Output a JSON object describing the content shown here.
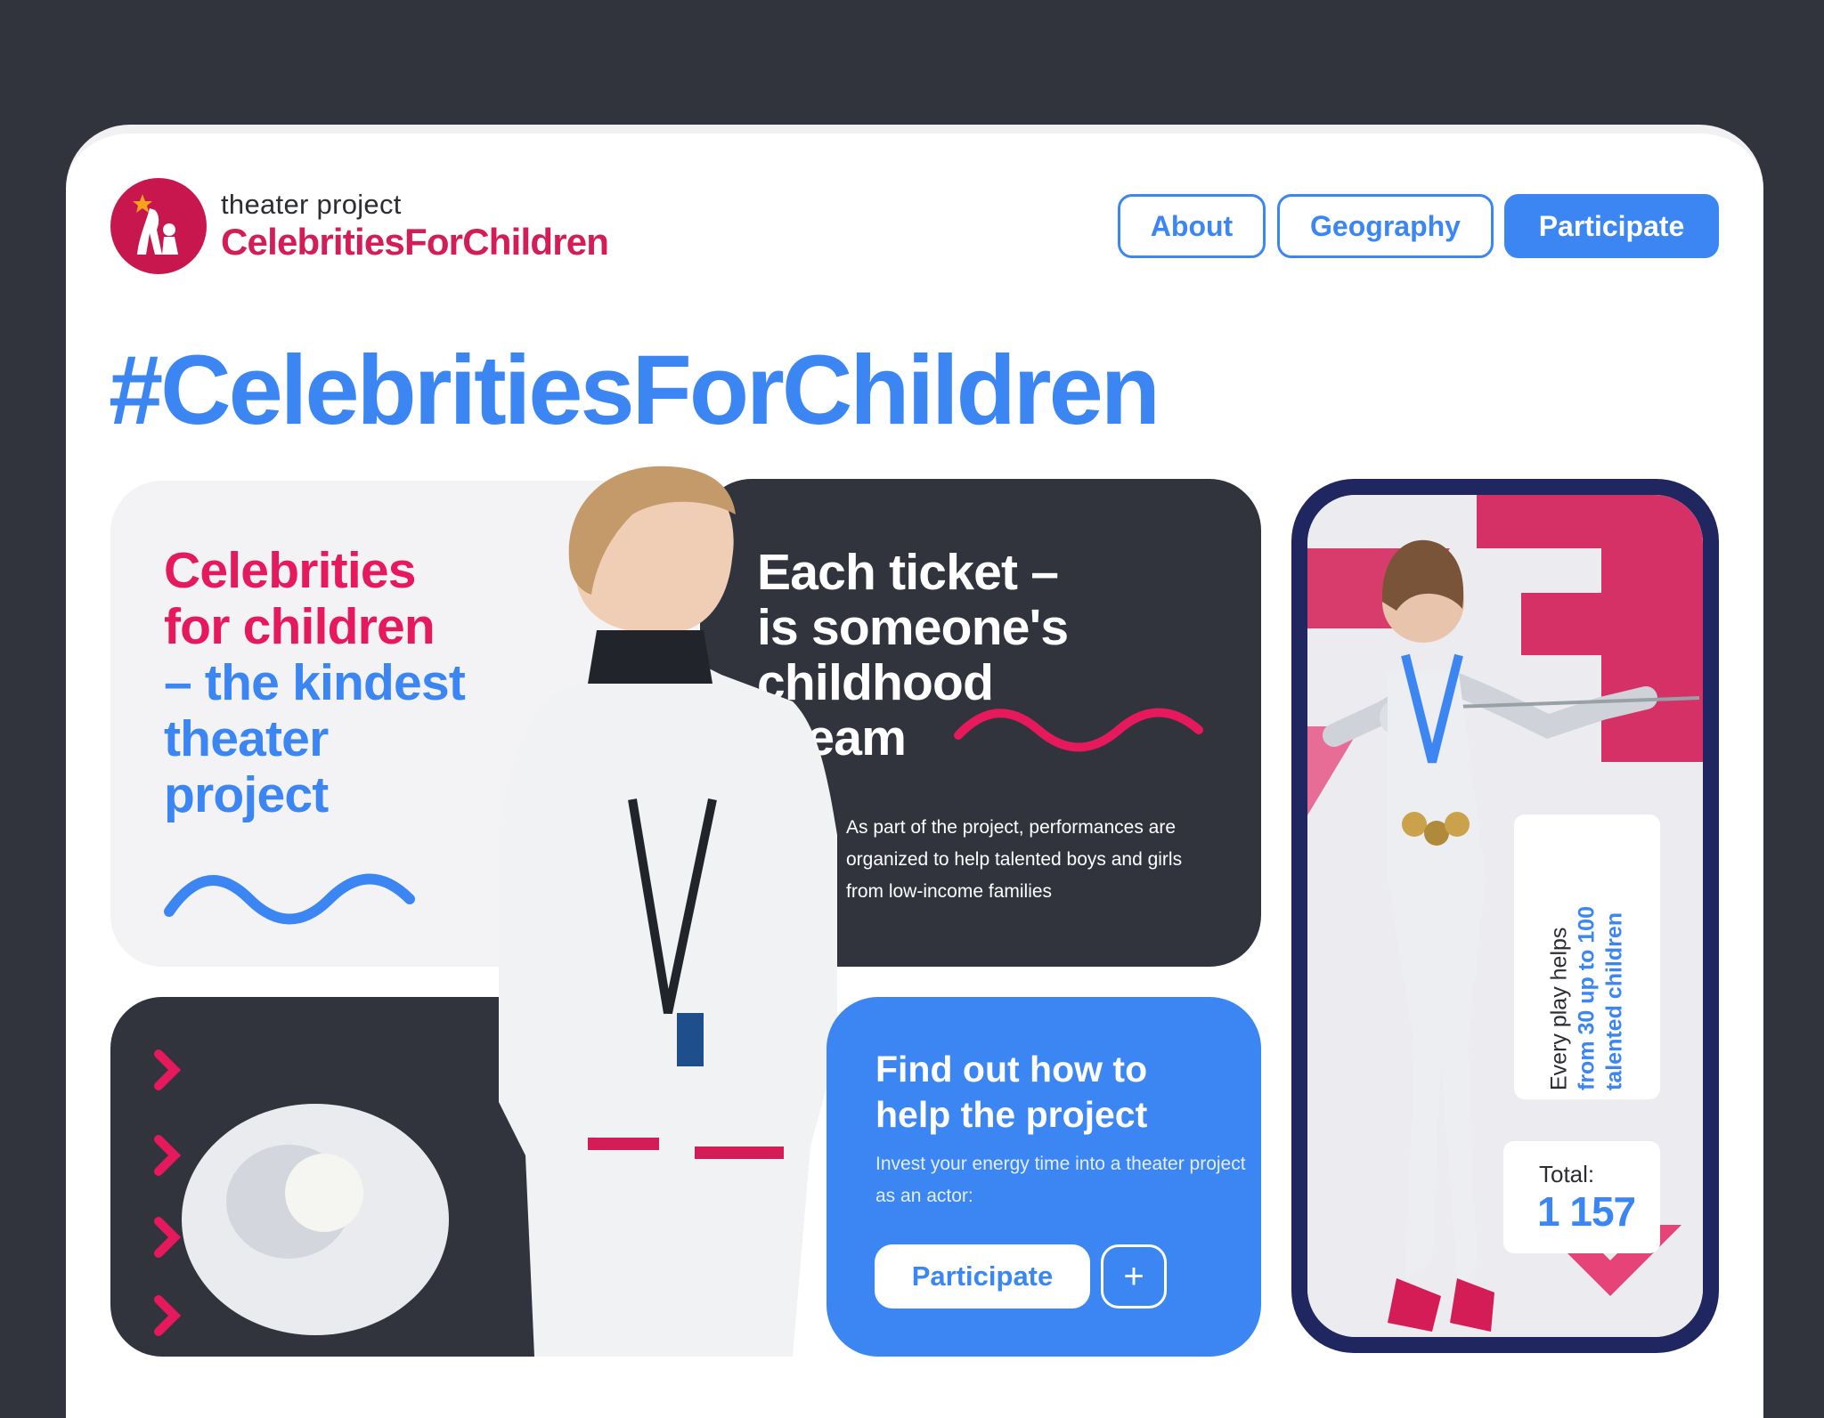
{
  "brand": {
    "tagline": "theater project",
    "name": "CelebritiesForChildren"
  },
  "nav": {
    "about": "About",
    "geography": "Geography",
    "participate": "Participate"
  },
  "hero": {
    "hashtag": "#CelebritiesForChildren"
  },
  "card_left": {
    "line1": "Celebrities",
    "line2": "for children",
    "line3": "– the kindest",
    "line4": "theater",
    "line5": "project"
  },
  "card_dark": {
    "line1": "Each ticket –",
    "line2": "is someone's",
    "line3": "childhood",
    "line4": "dream",
    "description": "As part of the project, performances are organized to help talented boys and girls from low-income families"
  },
  "card_blue": {
    "title_line1": "Find out how to",
    "title_line2": "help the project",
    "description": "Invest your energy time into a theater project as an actor:",
    "button": "Participate",
    "plus": "+"
  },
  "phone": {
    "stat_line1": "Every play helps",
    "stat_line2": "from 30 up to 100",
    "stat_line3": "talented children",
    "total_label": "Total:",
    "total_value": "1 157"
  },
  "colors": {
    "background": "#32343d",
    "accent_blue": "#3b86f3",
    "accent_pink": "#e5195b",
    "brand_red": "#c8174f"
  }
}
